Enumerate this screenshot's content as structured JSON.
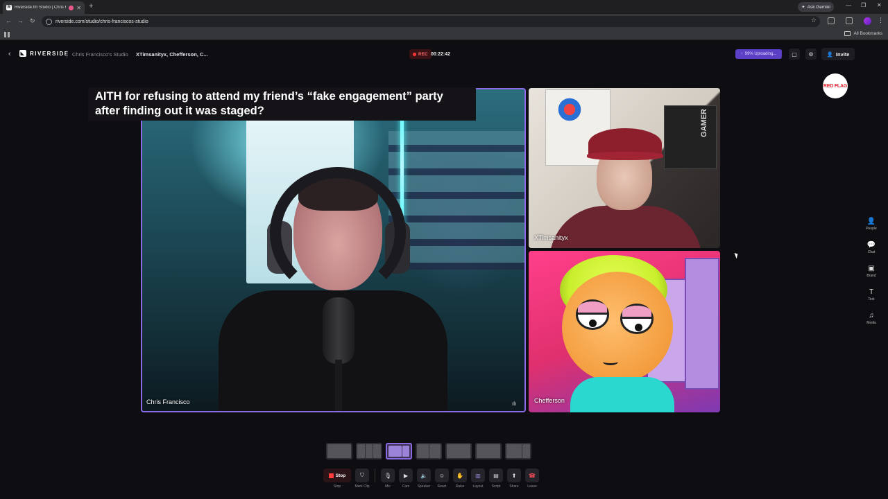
{
  "browser": {
    "tab_title": "Riverside.fm Studio | Chris F",
    "url": "riverside.com/studio/chris-franciscos-studio",
    "gemini_label": "Ask Gemini",
    "all_bookmarks": "All Bookmarks"
  },
  "header": {
    "logo": "RIVERSIDE",
    "studio_name": "Chris Francisco's Studio",
    "participants": "XTimsanityx, Chefferson, C...",
    "rec_label": "REC",
    "timer": "00:22:42",
    "upload_status": "99% Uploading...",
    "invite_label": "Invite"
  },
  "stage": {
    "caption": "AITH for refusing to attend my friend’s “fake engagement” party after finding out it was staged?",
    "main_name": "Chris Francisco",
    "top_right_name": "XTimsanityx",
    "bottom_right_name": "Chefferson",
    "gamer_text": "GAMER",
    "brand_logo_text": "RED FLAG"
  },
  "sidebar": {
    "items": [
      {
        "label": "People",
        "glyph": "👤"
      },
      {
        "label": "Chat",
        "glyph": "💬"
      },
      {
        "label": "Brand",
        "glyph": "▣"
      },
      {
        "label": "Text",
        "glyph": "T"
      },
      {
        "label": "Media",
        "glyph": "♫"
      }
    ]
  },
  "controls": {
    "stop": "Stop",
    "stop_caption": "Stop",
    "mark_clip": "Mark Clip",
    "mic": "Mic",
    "cam": "Cam",
    "speaker": "Speaker",
    "react": "React",
    "raise": "Raise",
    "layout": "Layout",
    "script": "Script",
    "share": "Share",
    "leave": "Leave"
  },
  "colors": {
    "accent": "#8b6ae6",
    "rec": "#ff3b3b",
    "upload": "#5b3fc4",
    "leave": "#ff4d5e"
  }
}
